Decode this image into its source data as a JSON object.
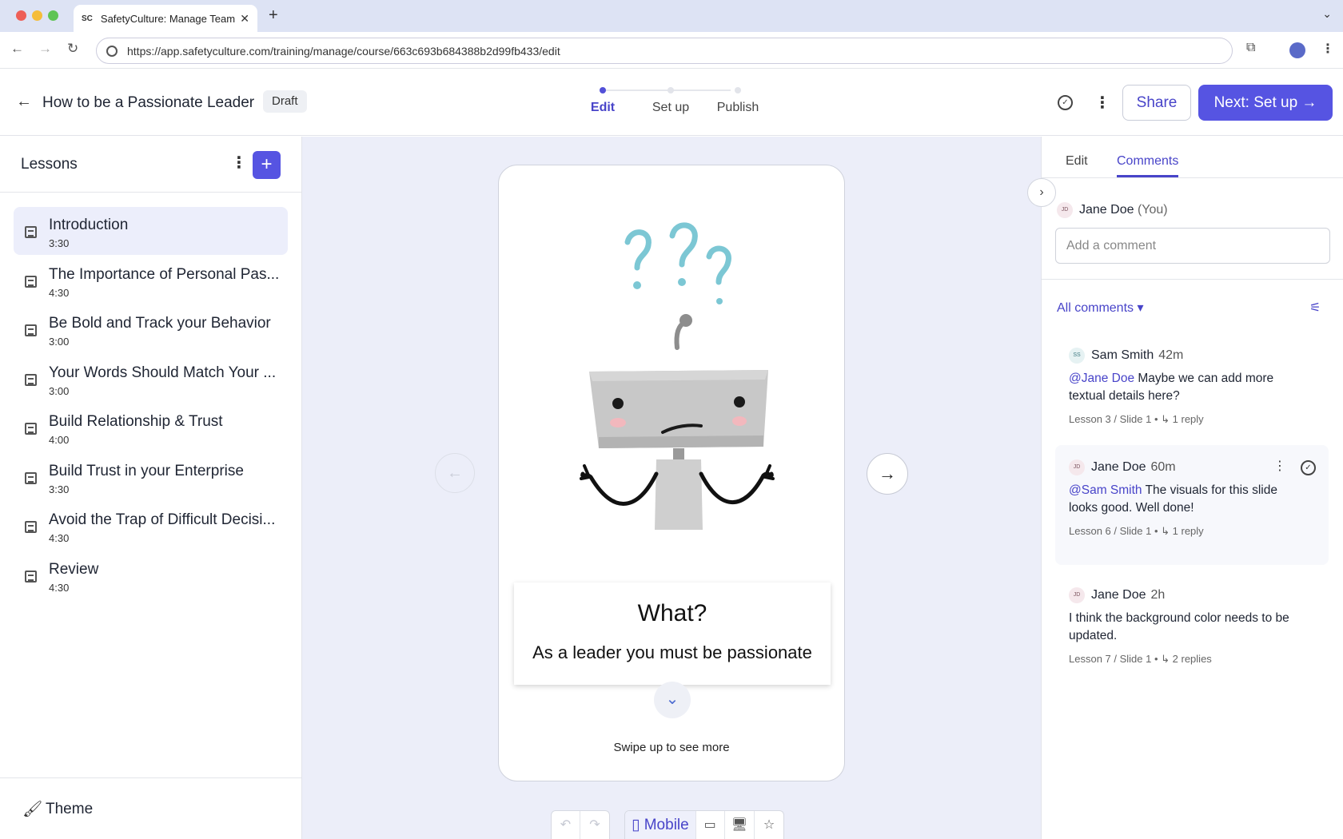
{
  "browser": {
    "tab_title": "SafetyCulture: Manage Teams",
    "tab_favicon": "SC",
    "url": "https://app.safetyculture.com/training/manage/course/663c693b684388b2d99fb433/edit"
  },
  "header": {
    "course_title": "How to be a Passionate Leader",
    "status_badge": "Draft",
    "steps": [
      {
        "label": "Edit",
        "active": true
      },
      {
        "label": "Set up",
        "active": false
      },
      {
        "label": "Publish",
        "active": false
      }
    ],
    "share_label": "Share",
    "next_label": "Next: Set up"
  },
  "lessons_panel": {
    "title": "Lessons",
    "add_icon": "plus-icon",
    "items": [
      {
        "name": "Introduction",
        "duration": "3:30"
      },
      {
        "name": "The Importance of Personal Pas...",
        "duration": "4:30"
      },
      {
        "name": "Be Bold and Track your Behavior",
        "duration": "3:00"
      },
      {
        "name": "Your Words Should Match Your ...",
        "duration": "3:00"
      },
      {
        "name": "Build Relationship & Trust",
        "duration": "4:00"
      },
      {
        "name": "Build Trust in your Enterprise",
        "duration": "3:30"
      },
      {
        "name": "Avoid the Trap of Difficult Decisi...",
        "duration": "4:30"
      },
      {
        "name": "Review",
        "duration": "4:30"
      }
    ],
    "theme_label": "Theme"
  },
  "slide": {
    "title": "What?",
    "body": "As a leader you must be passionate",
    "swipe_hint": "Swipe up to see more"
  },
  "preview_tools": {
    "device_label": "Mobile"
  },
  "comments_panel": {
    "tabs": [
      {
        "label": "Edit",
        "active": false
      },
      {
        "label": "Comments",
        "active": true
      }
    ],
    "current_user": {
      "initials": "JD",
      "name": "Jane Doe",
      "suffix": "(You)"
    },
    "input_placeholder": "Add a comment",
    "filter_label": "All comments",
    "comments": [
      {
        "initials": "SS",
        "author": "Sam Smith",
        "age": "42m",
        "mention": "@Jane Doe",
        "text": " Maybe we can add more textual details here?",
        "location": "Lesson 3 / Slide 1",
        "replies": "1 reply"
      },
      {
        "initials": "JD",
        "author": "Jane Doe",
        "age": "60m",
        "mention": "@Sam Smith",
        "text": " The visuals for this slide looks good. Well done!",
        "location": "Lesson 6 / Slide 1",
        "replies": "1 reply"
      },
      {
        "initials": "JD",
        "author": "Jane Doe",
        "age": "2h",
        "mention": "",
        "text": "I think the background color needs to be updated.",
        "location": "Lesson 7 / Slide 1",
        "replies": "2 replies"
      }
    ]
  },
  "colors": {
    "accent": "#5654e2",
    "canvas_bg": "#eceef9",
    "question_marks": "#7cc7d4"
  }
}
